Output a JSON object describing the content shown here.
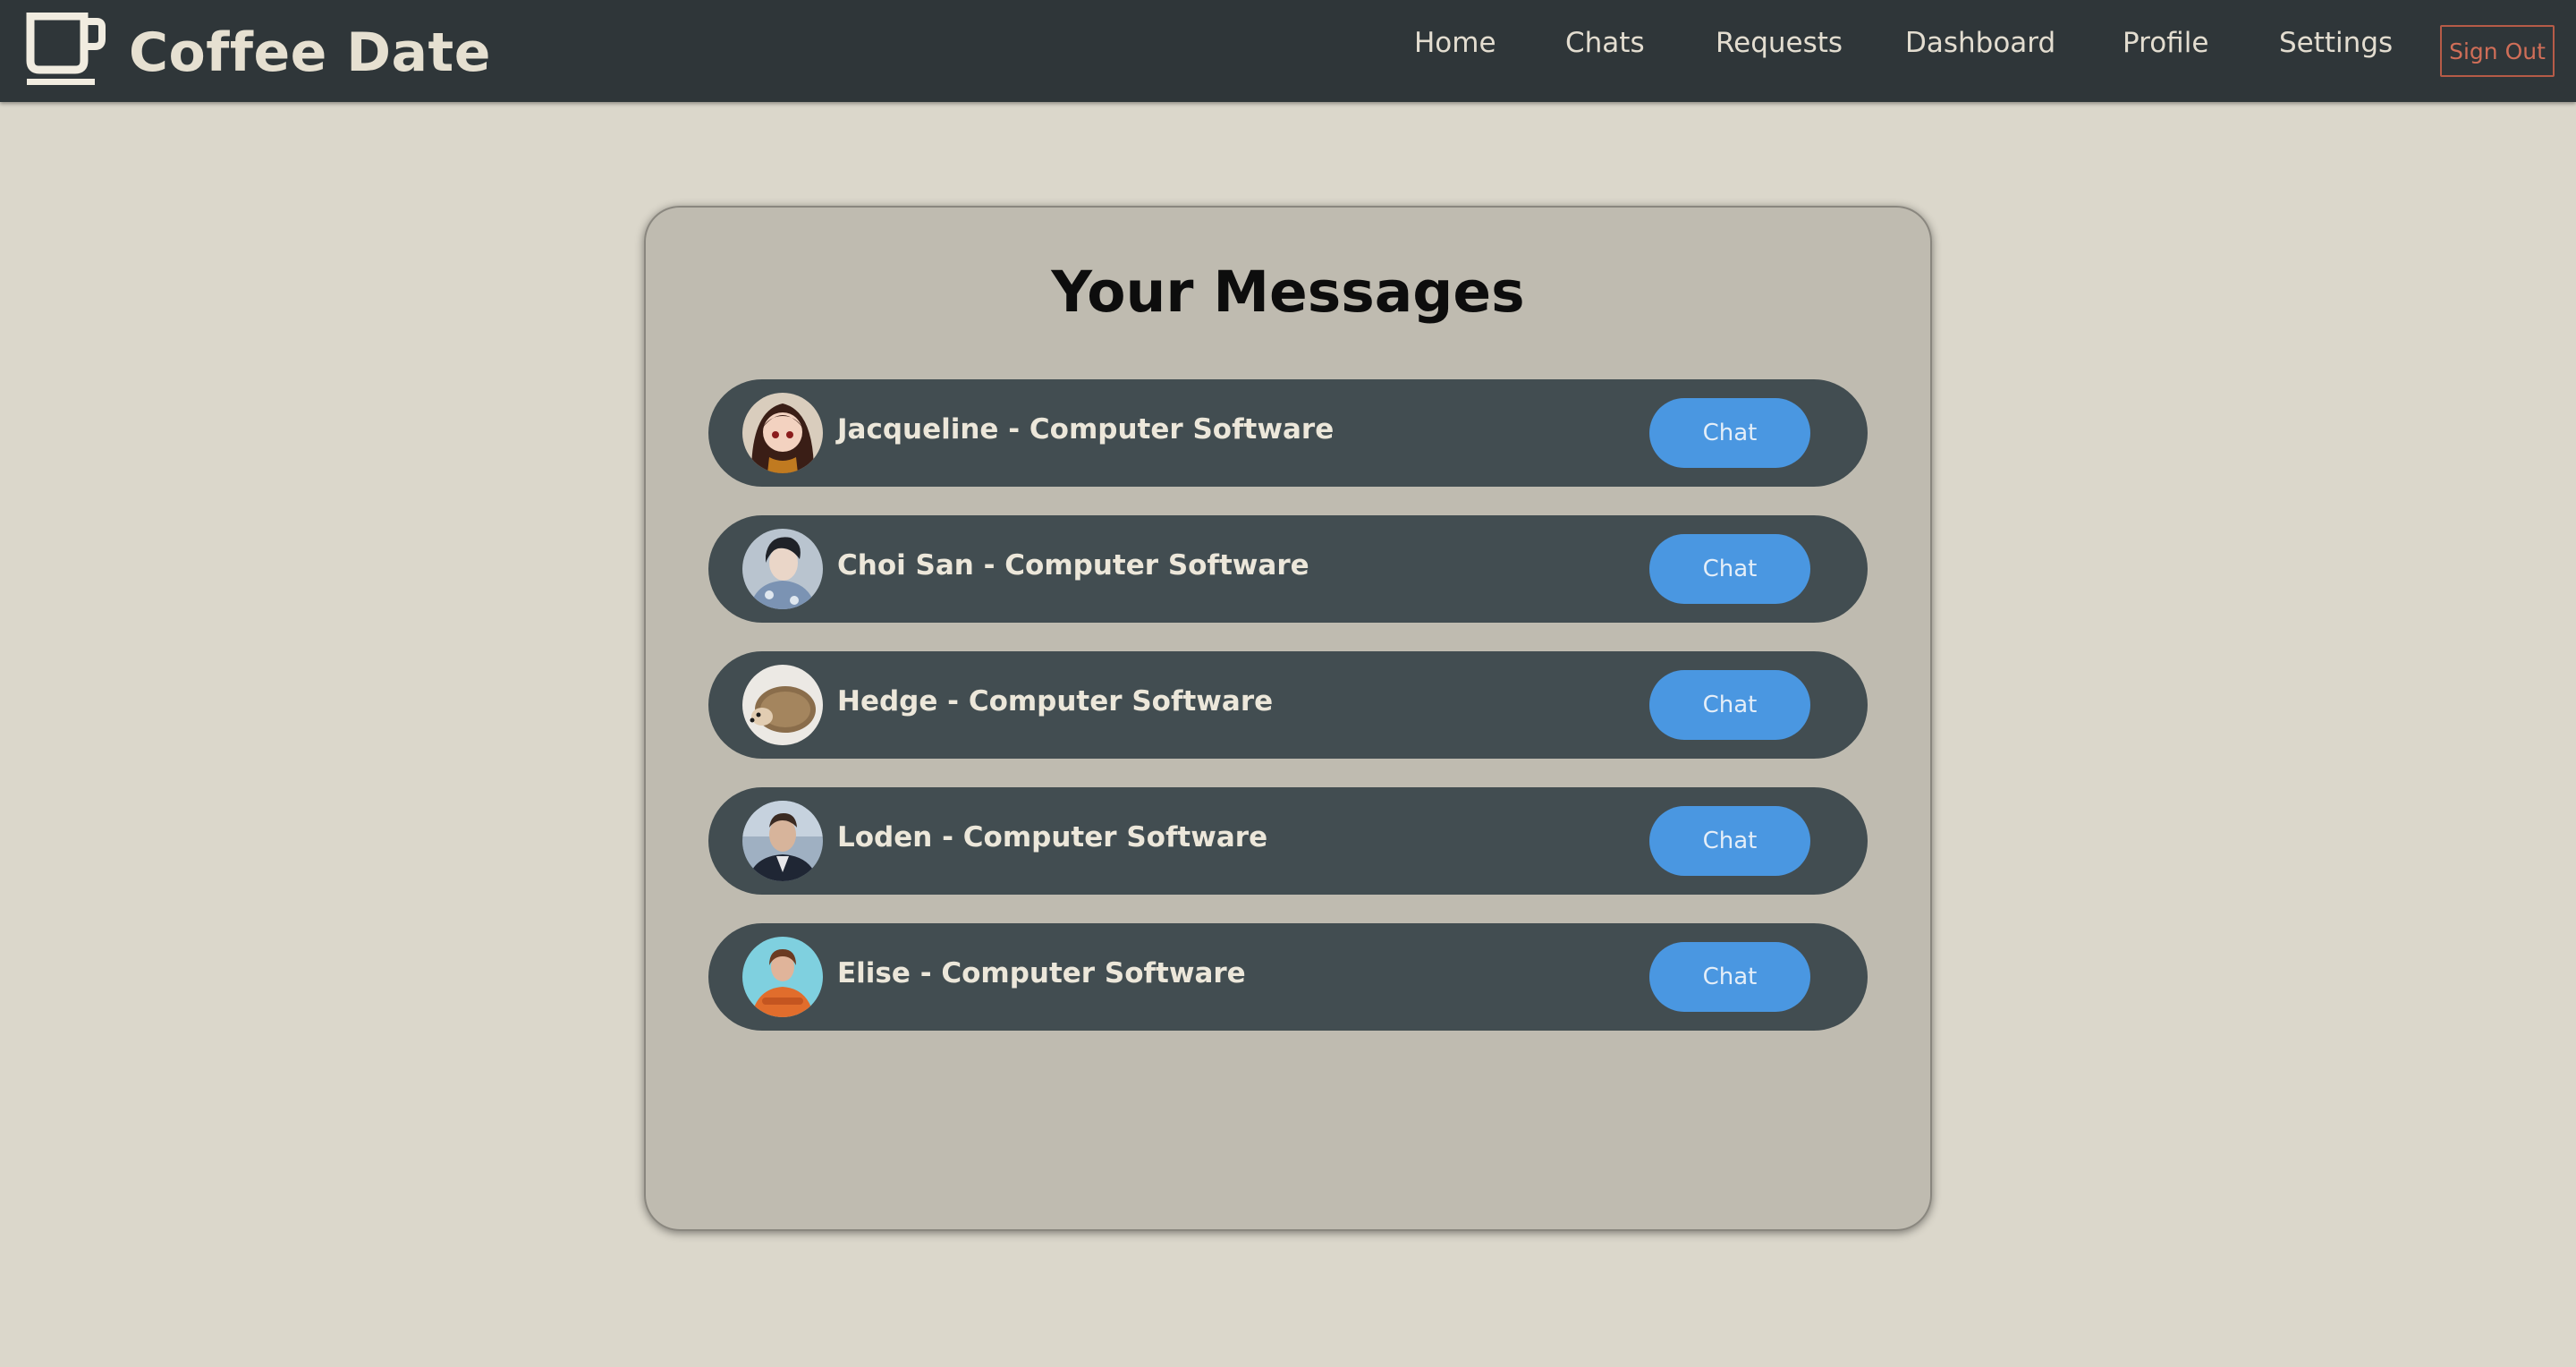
{
  "brand": {
    "name": "Coffee Date",
    "icon": "coffee-cup-icon"
  },
  "nav": {
    "items": [
      {
        "label": "Home"
      },
      {
        "label": "Chats"
      },
      {
        "label": "Requests"
      },
      {
        "label": "Dashboard"
      },
      {
        "label": "Profile"
      },
      {
        "label": "Settings"
      }
    ],
    "sign_out_label": "Sign Out"
  },
  "messages": {
    "title": "Your Messages",
    "conversations": [
      {
        "label": "Jacqueline - Computer Software",
        "button_label": "Chat",
        "avatar": "cartoon-girl-avatar"
      },
      {
        "label": "Choi San - Computer Software",
        "button_label": "Chat",
        "avatar": "person-photo-avatar"
      },
      {
        "label": "Hedge - Computer Software",
        "button_label": "Chat",
        "avatar": "hedgehog-avatar"
      },
      {
        "label": "Loden - Computer Software",
        "button_label": "Chat",
        "avatar": "man-in-suit-avatar"
      },
      {
        "label": "Elise - Computer Software",
        "button_label": "Chat",
        "avatar": "woman-orange-shirt-avatar"
      }
    ]
  },
  "colors": {
    "page_background": "#dbd7cb",
    "navbar": "#2f3639",
    "card": "#bfbbb0",
    "row": "#424d51",
    "chat_button": "#4a97e1",
    "sign_out": "#d06e58"
  }
}
